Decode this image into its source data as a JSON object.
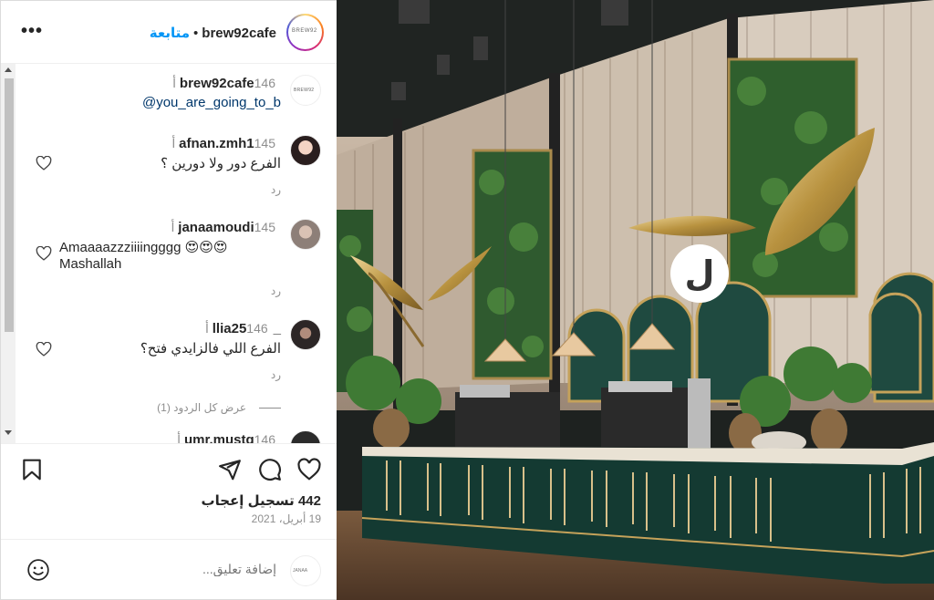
{
  "header": {
    "username": "brew92cafe",
    "separator": "•",
    "follow_label": "متابعة",
    "more_label": "•••",
    "avatar_text": "BREW92"
  },
  "comments": [
    {
      "username": "brew92cafe",
      "time": "146 أ",
      "text": "@you_are_going_to_b",
      "avatar_text": "BREW92",
      "reply": "",
      "has_heart": false
    },
    {
      "username": "afnan.zmh1",
      "time": "145 أ",
      "text": "الفرع دور ولا دورين ؟",
      "reply": "رد",
      "has_heart": true
    },
    {
      "username": "janaamoudi",
      "time": "145 أ",
      "text_line1": "Amaaaazzziiiingggg 😍😍😍",
      "text_line2": "Mashallah",
      "reply": "رد",
      "has_heart": true
    },
    {
      "username": "_llia25",
      "time": "146 أ",
      "text": "الفرع اللي فالزايدي فتح؟",
      "reply": "رد",
      "has_heart": true
    },
    {
      "username": "umr.mustq",
      "time": "146 أ"
    }
  ],
  "view_replies": "عرض كل الردود (1)",
  "actions": {
    "likes": "442 تسجيل إعجاب",
    "date": "19 أبريل، 2021"
  },
  "add_comment": {
    "placeholder": "إضافة تعليق...",
    "avatar_text": "JANAA"
  },
  "photo": {
    "signage_glyph": "ل"
  }
}
